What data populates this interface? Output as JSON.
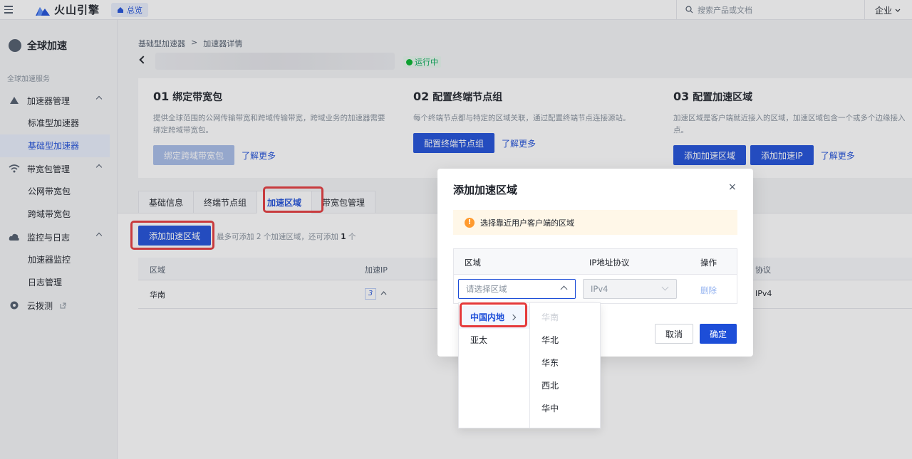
{
  "topbar": {
    "logo_text": "火山引擎",
    "home_label": "总览",
    "search_placeholder": "搜索产品或文档",
    "enterprise_label": "企业"
  },
  "sidebar": {
    "title": "全球加速",
    "section_label": "全球加速服务",
    "groups": [
      {
        "label": "加速器管理",
        "items": [
          "标准型加速器",
          "基础型加速器"
        ]
      },
      {
        "label": "带宽包管理",
        "items": [
          "公网带宽包",
          "跨域带宽包"
        ]
      },
      {
        "label": "监控与日志",
        "items": [
          "加速器监控",
          "日志管理"
        ]
      },
      {
        "label": "云拨测",
        "items": []
      }
    ],
    "active_item": "基础型加速器"
  },
  "breadcrumb": {
    "parent": "基础型加速器",
    "separator": ">",
    "current": "加速器详情"
  },
  "status_label": "运行中",
  "steps": [
    {
      "num": "01",
      "title": "绑定带宽包",
      "desc": "提供全球范围的公网传输带宽和跨域传输带宽，跨域业务的加速器需要绑定跨域带宽包。",
      "buttons": [
        "绑定跨域带宽包"
      ],
      "link": "了解更多"
    },
    {
      "num": "02",
      "title": "配置终端节点组",
      "desc": "每个终端节点都与特定的区域关联，通过配置终端节点连接源站。",
      "buttons": [
        "配置终端节点组"
      ],
      "link": "了解更多"
    },
    {
      "num": "03",
      "title": "配置加速区域",
      "desc": "加速区域是客户端就近接入的区域，加速区域包含一个或多个边缘接入点。",
      "buttons": [
        "添加加速区域",
        "添加加速IP"
      ],
      "link": "了解更多"
    }
  ],
  "tabs": [
    "基础信息",
    "终端节点组",
    "加速区域",
    "带宽包管理"
  ],
  "active_tab": "加速区域",
  "zone_panel": {
    "add_button": "添加加速区域",
    "hint_prefix": "最多可添加",
    "hint_max": "2",
    "hint_middle": "个加速区域，还可添加",
    "hint_remain": "1",
    "hint_suffix": "个",
    "columns": [
      "区域",
      "加速IP",
      "协议"
    ],
    "rows": [
      {
        "region": "华南",
        "ip_count": "3",
        "protocol": "IPv4"
      }
    ]
  },
  "modal": {
    "title": "添加加速区域",
    "close": "×",
    "alert": "选择靠近用户客户端的区域",
    "columns": [
      "区域",
      "IP地址协议",
      "操作"
    ],
    "region_placeholder": "请选择区域",
    "protocol_value": "IPv4",
    "delete_label": "删除",
    "cancel_label": "取消",
    "ok_label": "确定"
  },
  "cascader": {
    "level1": [
      "中国内地",
      "亚太"
    ],
    "level2": [
      "华南",
      "华北",
      "华东",
      "西北",
      "华中"
    ],
    "active_level1": "中国内地",
    "disabled_level2": "华南"
  },
  "colors": {
    "primary": "#1d4ed8",
    "highlight": "#e5393b",
    "success": "#00b42a",
    "warning": "#ff9a2e"
  }
}
